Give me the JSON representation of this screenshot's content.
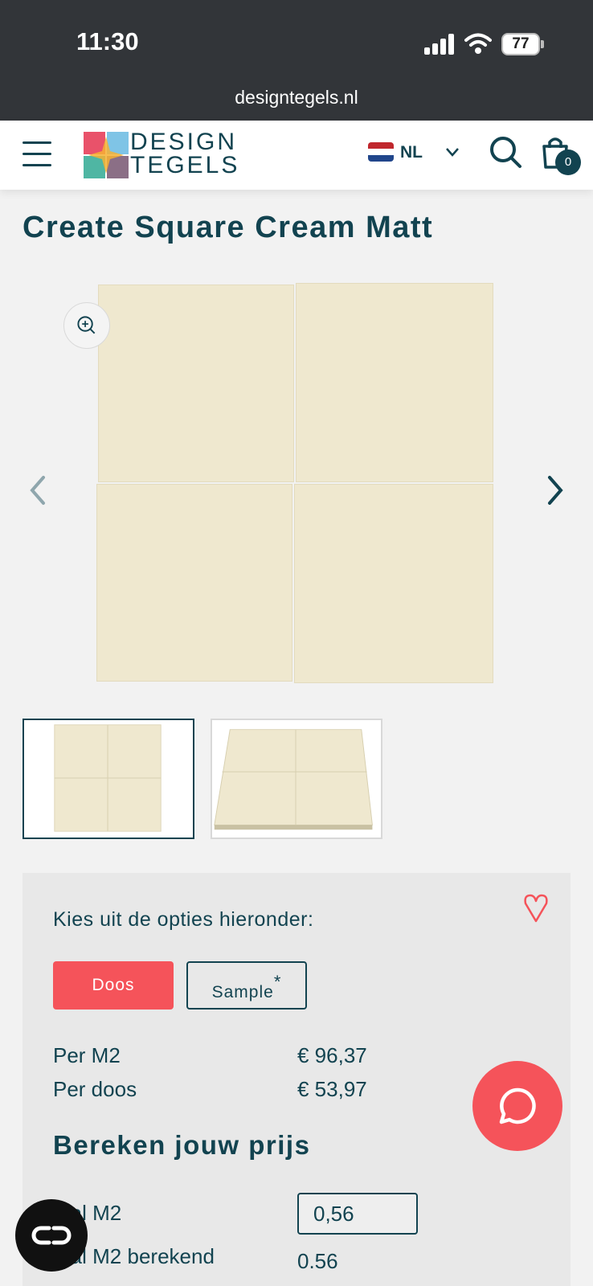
{
  "status_bar": {
    "time": "11:30",
    "battery": "77",
    "url": "designtegels.nl"
  },
  "header": {
    "logo_line1": "DESIGN",
    "logo_line2": "TEGELS",
    "language": "NL",
    "cart_count": "0"
  },
  "product": {
    "title": "Create Square Cream Matt",
    "tile_color": "#efe8cf"
  },
  "options": {
    "prompt": "Kies uit de opties hieronder:",
    "doos_label": "Doos",
    "sample_label": "Sample",
    "sample_mark": "*",
    "per_m2_label": "Per M2",
    "per_m2_value": "€ 96,37",
    "per_doos_label": "Per doos",
    "per_doos_value": "€ 53,97"
  },
  "calculator": {
    "title": "Bereken jouw prijs",
    "aantal_label": "ntal M2",
    "aantal_value": "0,56",
    "berekend_label": "ntal M2 berekend",
    "berekend_value": "0.56"
  },
  "colors": {
    "brand": "#124350",
    "accent": "#f5535a"
  }
}
